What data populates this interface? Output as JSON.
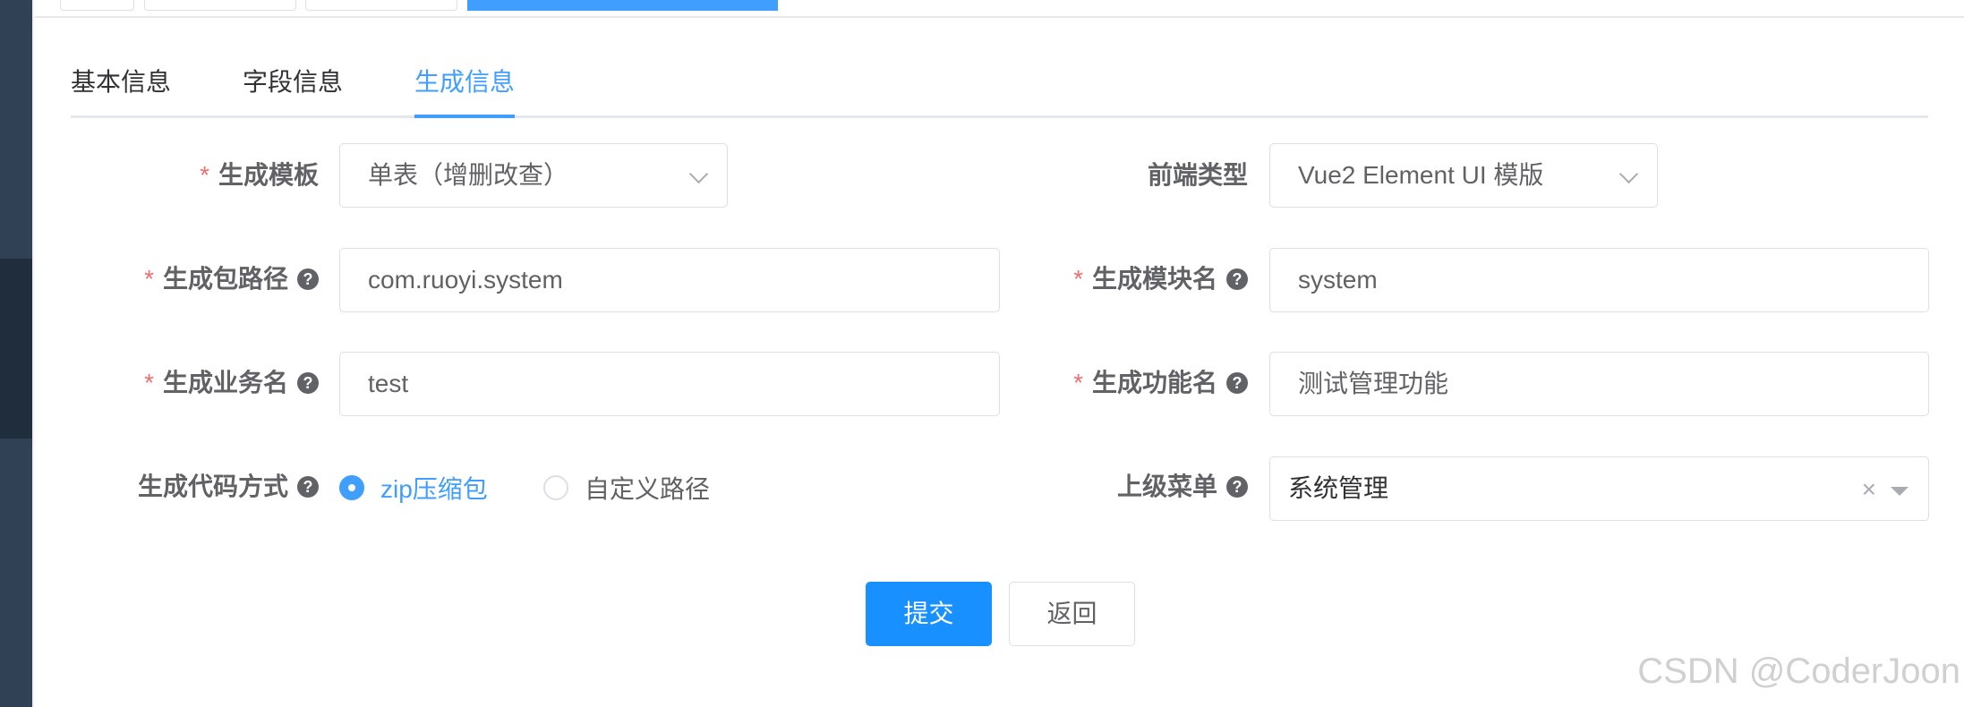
{
  "tabs": [
    {
      "label": "基本信息"
    },
    {
      "label": "字段信息"
    },
    {
      "label": "生成信息",
      "active": true
    }
  ],
  "form": {
    "template": {
      "label": "生成模板",
      "value": "单表（增删改查）"
    },
    "frontend_type": {
      "label": "前端类型",
      "value": "Vue2 Element UI 模版"
    },
    "package_path": {
      "label": "生成包路径",
      "value": "com.ruoyi.system"
    },
    "module_name": {
      "label": "生成模块名",
      "value": "system"
    },
    "business_name": {
      "label": "生成业务名",
      "value": "test"
    },
    "function_name": {
      "label": "生成功能名",
      "value": "测试管理功能"
    },
    "gen_type": {
      "label": "生成代码方式",
      "options": [
        "zip压缩包",
        "自定义路径"
      ],
      "selected": "zip压缩包"
    },
    "parent_menu": {
      "label": "上级菜单",
      "value": "系统管理",
      "clear_icon": "×"
    }
  },
  "required_mark": "*",
  "help_icon": "?",
  "buttons": {
    "submit": "提交",
    "back": "返回"
  },
  "watermark": "CSDN @CoderJoon",
  "colors": {
    "primary": "#409eff",
    "required": "#f56c6c",
    "sidebar": "#304156"
  }
}
